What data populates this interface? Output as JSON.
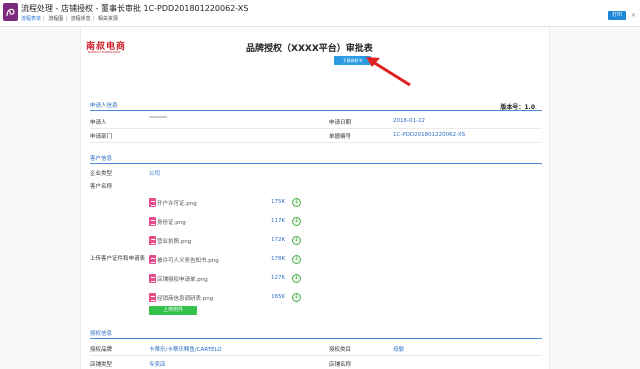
{
  "window": {
    "title": "流程处理 - 店铺授权 - 董事长审批 1C-PDD201801220062-XS",
    "tabs": [
      "流程表单",
      "流程图",
      "流程状态",
      "相关资源"
    ],
    "top_button": "打印",
    "top_close": "✕"
  },
  "form": {
    "logo_text": "南叔电商",
    "logo_sub": "NANSHU DIANSHANG",
    "title": "品牌授权（XXXX平台）审批表",
    "download_label": "下载授权书",
    "version": "版本号：1.0"
  },
  "applicant": {
    "section": "申请人信息",
    "applicant_label": "申请人",
    "dept_label": "申请部门",
    "date_label": "申请日期",
    "date_value": "2018-01-22",
    "doc_label": "单据编号",
    "doc_value": "1C-PDD201801220062-XS"
  },
  "customer": {
    "section": "客户信息",
    "type_label": "企业类型",
    "type_value": "公司",
    "name_label": "客户名称",
    "upload_label": "上传客户证件和申请表",
    "files": [
      {
        "name": "开户许可证.png",
        "size": "175K"
      },
      {
        "name": "身份证.png",
        "size": "117K"
      },
      {
        "name": "营业执照.png",
        "size": "172K"
      },
      {
        "name": "被许可人义务告知书.png",
        "size": "178K"
      },
      {
        "name": "店铺授权申请单.png",
        "size": "127K"
      },
      {
        "name": "经销商信息调研表.png",
        "size": "165K"
      }
    ],
    "upload_button": "上传附件"
  },
  "auth": {
    "section": "授权信息",
    "brand_label": "授权品牌",
    "brand_value": "卡蒂乐/卡蒂乐鳄鱼/CARTELO",
    "category_label": "授权类目",
    "category_value": "母婴",
    "shop_type_label": "店铺类型",
    "shop_type_value": "专卖店",
    "shop_name_label": "店铺名称"
  },
  "colors": {
    "accent": "#2c6fc4",
    "download_button": "#2a9be3",
    "upload_button": "#35c24a",
    "arrow": "#e02020",
    "logo": "#d0202a"
  }
}
